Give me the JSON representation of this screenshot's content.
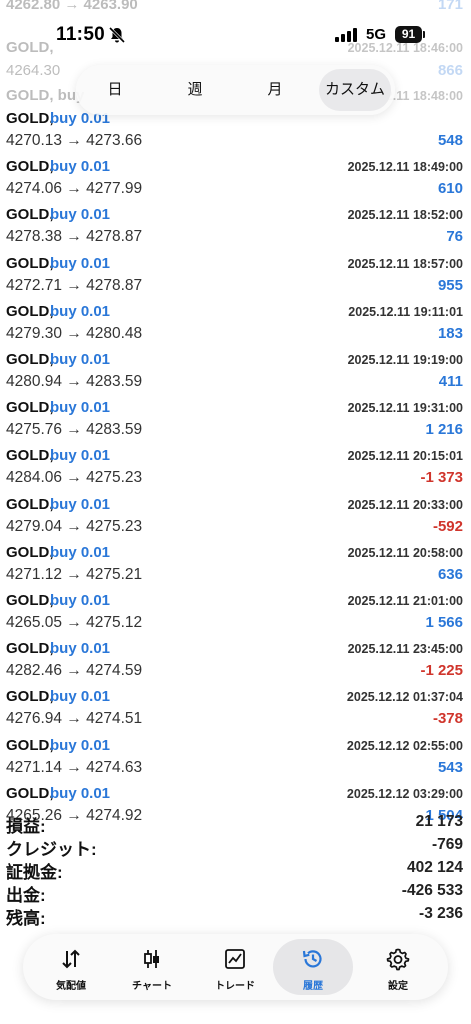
{
  "status_bar": {
    "time": "11:50",
    "network": "5G",
    "battery": "91"
  },
  "faded_rows": [
    {
      "left": "4262.80 → 4263.90",
      "right": "171"
    },
    {
      "left": "GOLD,",
      "right": "2025.12.11 18:46:00"
    },
    {
      "left": "4264.30",
      "right": "866"
    },
    {
      "left": "GOLD, buy",
      "right": "2025.12.11 18:48:00"
    }
  ],
  "period_tabs": [
    {
      "label": "日",
      "active": false
    },
    {
      "label": "週",
      "active": false
    },
    {
      "label": "月",
      "active": false
    },
    {
      "label": "カスタム",
      "active": true
    }
  ],
  "trades": [
    {
      "symbol": "GOLD,",
      "direction": "buy 0.01",
      "prices": "4270.13 → 4273.66",
      "datetime": "",
      "profit": "548",
      "type": "pos"
    },
    {
      "symbol": "GOLD,",
      "direction": "buy 0.01",
      "prices": "4274.06 → 4277.99",
      "datetime": "2025.12.11 18:49:00",
      "profit": "610",
      "type": "pos"
    },
    {
      "symbol": "GOLD,",
      "direction": "buy 0.01",
      "prices": "4278.38 → 4278.87",
      "datetime": "2025.12.11 18:52:00",
      "profit": "76",
      "type": "pos"
    },
    {
      "symbol": "GOLD,",
      "direction": "buy 0.01",
      "prices": "4272.71 → 4278.87",
      "datetime": "2025.12.11 18:57:00",
      "profit": "955",
      "type": "pos"
    },
    {
      "symbol": "GOLD,",
      "direction": "buy 0.01",
      "prices": "4279.30 → 4280.48",
      "datetime": "2025.12.11 19:11:01",
      "profit": "183",
      "type": "pos"
    },
    {
      "symbol": "GOLD,",
      "direction": "buy 0.01",
      "prices": "4280.94 → 4283.59",
      "datetime": "2025.12.11 19:19:00",
      "profit": "411",
      "type": "pos"
    },
    {
      "symbol": "GOLD,",
      "direction": "buy 0.01",
      "prices": "4275.76 → 4283.59",
      "datetime": "2025.12.11 19:31:00",
      "profit": "1 216",
      "type": "pos"
    },
    {
      "symbol": "GOLD,",
      "direction": "buy 0.01",
      "prices": "4284.06 → 4275.23",
      "datetime": "2025.12.11 20:15:01",
      "profit": "-1 373",
      "type": "neg"
    },
    {
      "symbol": "GOLD,",
      "direction": "buy 0.01",
      "prices": "4279.04 → 4275.23",
      "datetime": "2025.12.11 20:33:00",
      "profit": "-592",
      "type": "neg"
    },
    {
      "symbol": "GOLD,",
      "direction": "buy 0.01",
      "prices": "4271.12 → 4275.21",
      "datetime": "2025.12.11 20:58:00",
      "profit": "636",
      "type": "pos"
    },
    {
      "symbol": "GOLD,",
      "direction": "buy 0.01",
      "prices": "4265.05 → 4275.12",
      "datetime": "2025.12.11 21:01:00",
      "profit": "1 566",
      "type": "pos"
    },
    {
      "symbol": "GOLD,",
      "direction": "buy 0.01",
      "prices": "4282.46 → 4274.59",
      "datetime": "2025.12.11 23:45:00",
      "profit": "-1 225",
      "type": "neg"
    },
    {
      "symbol": "GOLD,",
      "direction": "buy 0.01",
      "prices": "4276.94 → 4274.51",
      "datetime": "2025.12.12 01:37:04",
      "profit": "-378",
      "type": "neg"
    },
    {
      "symbol": "GOLD,",
      "direction": "buy 0.01",
      "prices": "4271.14 → 4274.63",
      "datetime": "2025.12.12 02:55:00",
      "profit": "543",
      "type": "pos"
    },
    {
      "symbol": "GOLD,",
      "direction": "buy 0.01",
      "prices": "4265.26 → 4274.92",
      "datetime": "2025.12.12 03:29:00",
      "profit": "1 504",
      "type": "pos"
    }
  ],
  "summary": [
    {
      "label": "損益:",
      "value": "21 173"
    },
    {
      "label": "クレジット:",
      "value": "-769"
    },
    {
      "label": "証拠金:",
      "value": "402 124"
    },
    {
      "label": "出金:",
      "value": "-426 533"
    },
    {
      "label": "残高:",
      "value": "-3 236"
    }
  ],
  "tab_bar": [
    {
      "label": "気配値",
      "icon": "quotes-icon",
      "active": false
    },
    {
      "label": "チャート",
      "icon": "candlestick-icon",
      "active": false
    },
    {
      "label": "トレード",
      "icon": "trade-chart-icon",
      "active": false
    },
    {
      "label": "履歴",
      "icon": "history-icon",
      "active": true
    },
    {
      "label": "設定",
      "icon": "gear-icon",
      "active": false
    }
  ],
  "colors": {
    "accent": "#2a77d8",
    "loss": "#d0352c"
  }
}
